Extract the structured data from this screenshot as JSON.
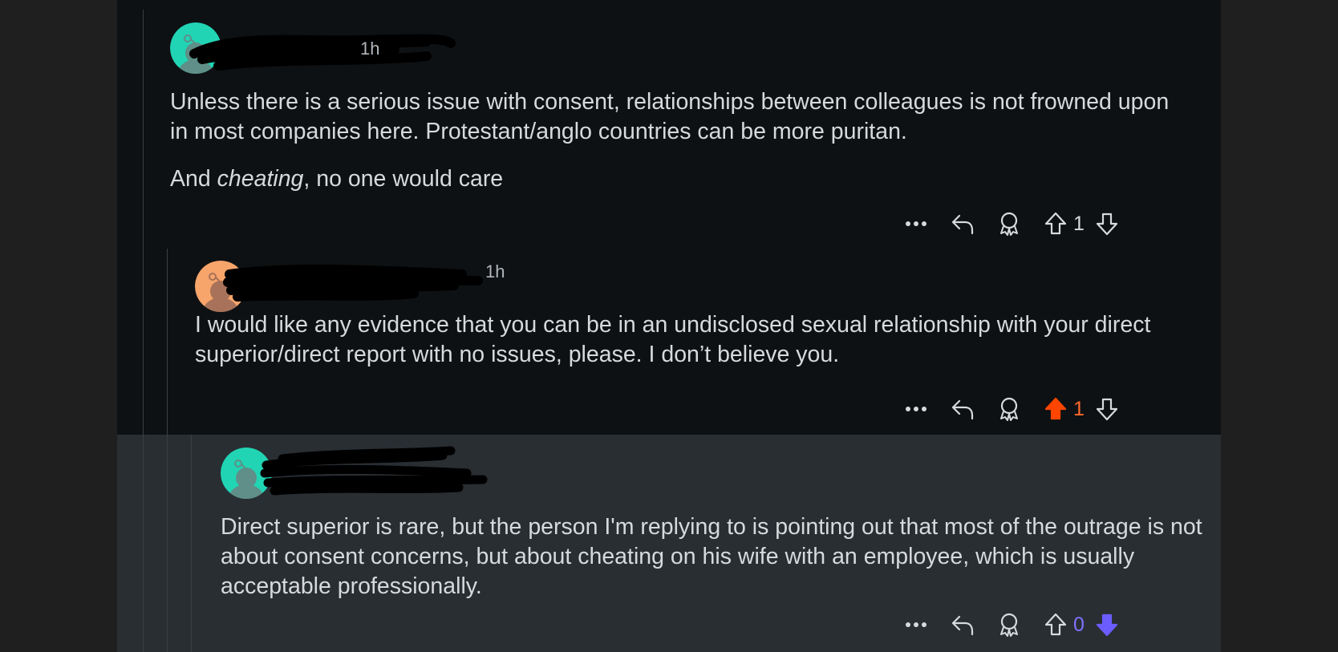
{
  "colors": {
    "page_bg": "#1c1c1c",
    "panel_bg": "#0e1113",
    "highlight_bg": "#292e33",
    "text": "#d7dadc",
    "muted": "#b0b6bb",
    "upvote_active": "#ff4500",
    "downvote_active": "#6a5cff"
  },
  "comments": [
    {
      "avatar_color": "#21d4b4",
      "time": "1h",
      "paragraphs": [
        "Unless there is a serious issue with consent, relationships between colleagues is not frowned upon in most companies here. Protestant/anglo countries can be more puritan."
      ],
      "last_para_prefix": "And ",
      "last_para_emph": "cheating",
      "last_para_suffix": ", no one would care",
      "score": "1",
      "vote_state": "none"
    },
    {
      "avatar_color": "#f7a56b",
      "time": "1h",
      "paragraphs": [
        "I would like any evidence that you can be in an undisclosed sexual relationship with your direct superior/direct report with no issues, please. I don’t believe you."
      ],
      "score": "1",
      "vote_state": "up"
    },
    {
      "avatar_color": "#21d4b4",
      "time": "",
      "paragraphs": [
        "Direct superior is rare, but the person I'm replying to is pointing out that most of the outrage is not about consent concerns, but about cheating on his wife with an employee, which is usually acceptable professionally."
      ],
      "score": "0",
      "vote_state": "down"
    }
  ],
  "icons": {
    "more": "more-dots-icon",
    "reply": "reply-arrow-icon",
    "award": "award-icon",
    "upvote": "upvote-arrow-icon",
    "downvote": "downvote-arrow-icon"
  }
}
